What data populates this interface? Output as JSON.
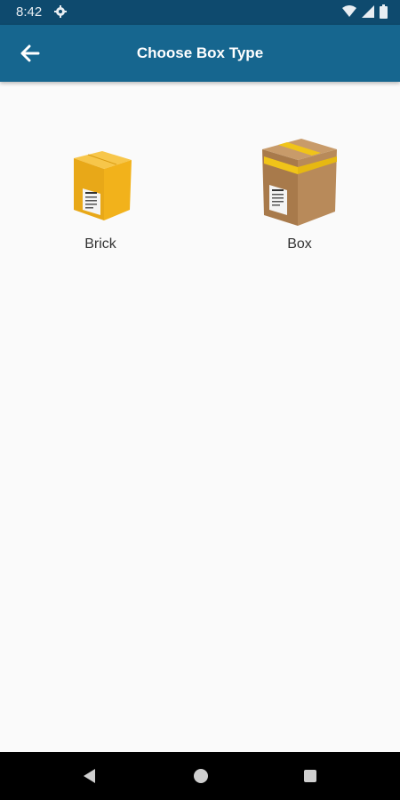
{
  "status_bar": {
    "time": "8:42",
    "icons": [
      "gear-icon",
      "wifi-icon",
      "signal-icon",
      "battery-icon"
    ]
  },
  "app_bar": {
    "title": "Choose Box Type",
    "back_icon": "arrow-left-icon",
    "color": "#16668f"
  },
  "options": [
    {
      "label": "Brick",
      "icon": "yellow-brick-box-icon"
    },
    {
      "label": "Box",
      "icon": "cardboard-box-icon"
    }
  ],
  "nav_bar": {
    "icons": [
      "nav-back-icon",
      "nav-home-icon",
      "nav-recent-icon"
    ]
  },
  "colors": {
    "status_bar": "#0e4a6e",
    "app_bar": "#16668f",
    "background": "#fafafa",
    "brick_yellow": "#f2b21b",
    "box_brown": "#b88a5a"
  }
}
